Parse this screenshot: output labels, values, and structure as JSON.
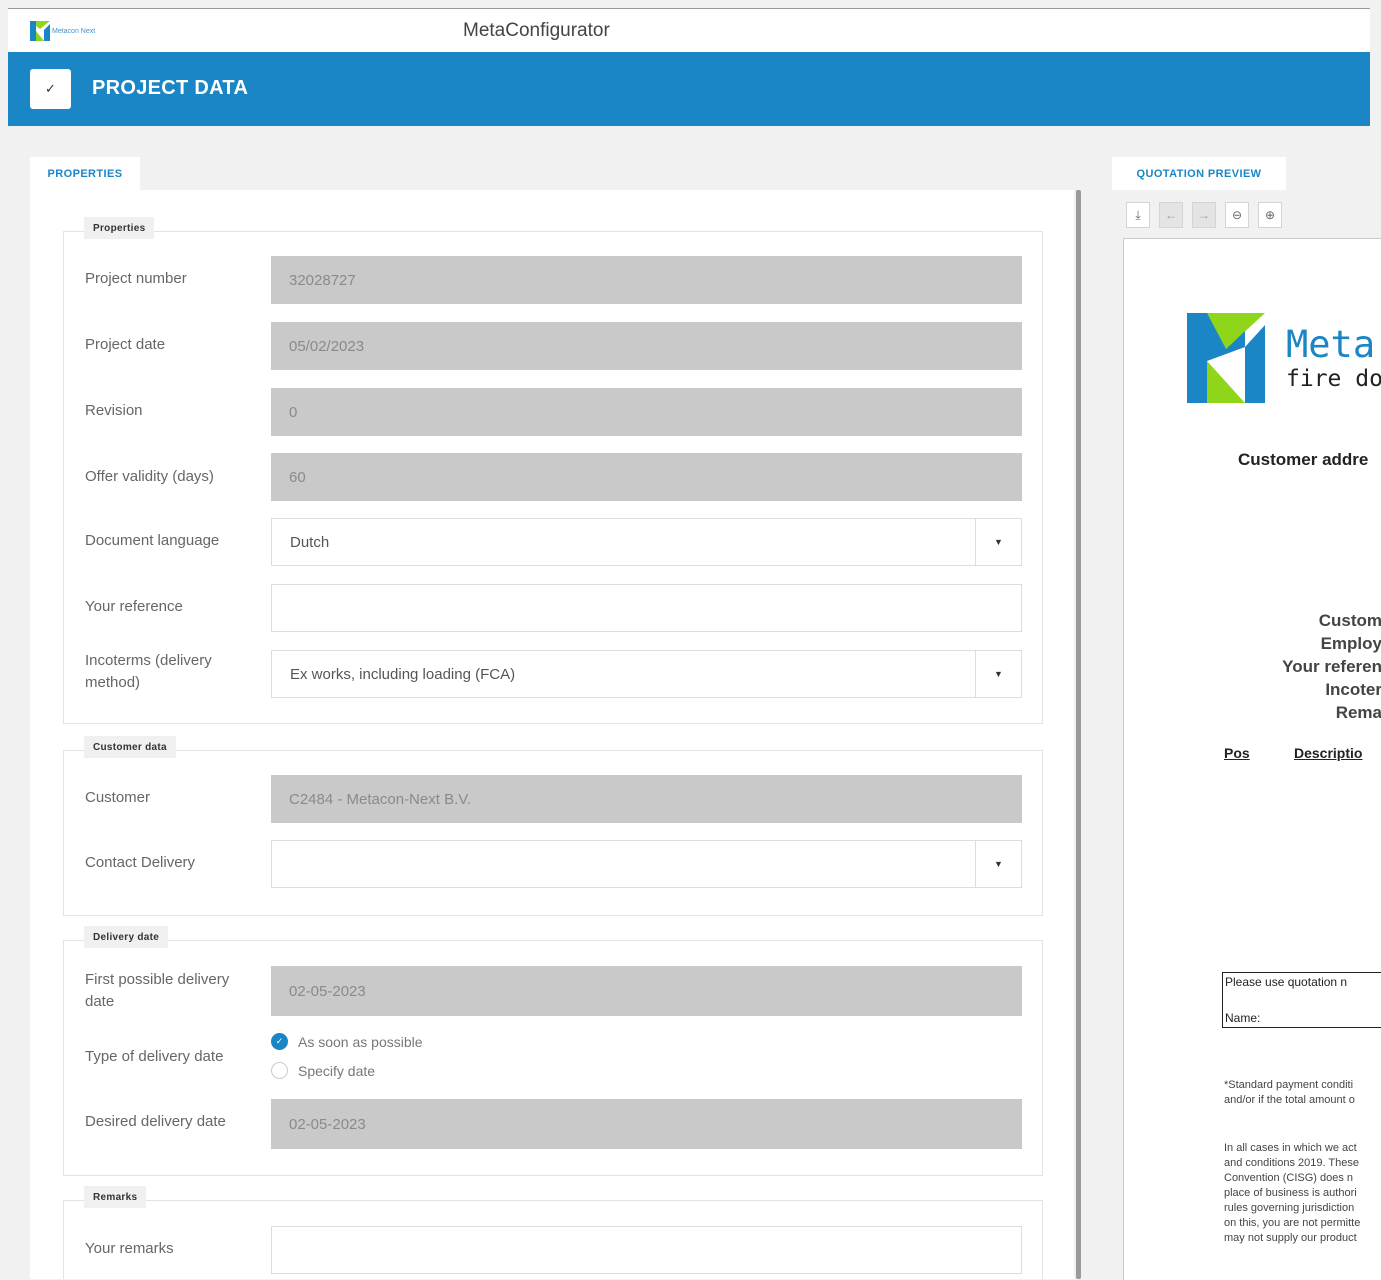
{
  "app": {
    "logo_text": "Metacon Next",
    "title": "MetaConfigurator"
  },
  "header": {
    "check_icon": "check-icon",
    "title": "PROJECT DATA"
  },
  "tabs": {
    "properties": "PROPERTIES",
    "preview": "QUOTATION PREVIEW"
  },
  "sections": {
    "properties": {
      "legend": "Properties",
      "project_number": {
        "label": "Project number",
        "value": "32028727"
      },
      "project_date": {
        "label": "Project date",
        "value": "05/02/2023"
      },
      "revision": {
        "label": "Revision",
        "value": "0"
      },
      "offer_validity": {
        "label": "Offer validity (days)",
        "value": "60"
      },
      "document_language": {
        "label": "Document language",
        "value": "Dutch"
      },
      "your_reference": {
        "label": "Your reference",
        "value": ""
      },
      "incoterms": {
        "label": "Incoterms (delivery method)",
        "value": "Ex works, including loading (FCA)"
      }
    },
    "customer": {
      "legend": "Customer data",
      "customer": {
        "label": "Customer",
        "value": "C2484 - Metacon-Next B.V."
      },
      "contact_delivery": {
        "label": "Contact Delivery",
        "value": ""
      }
    },
    "delivery": {
      "legend": "Delivery date",
      "first_possible": {
        "label": "First possible delivery date",
        "value": "02-05-2023"
      },
      "type": {
        "label": "Type of delivery date",
        "options": [
          "As soon as possible",
          "Specify date"
        ],
        "selected": "As soon as possible"
      },
      "desired": {
        "label": "Desired delivery date",
        "value": "02-05-2023"
      }
    },
    "remarks": {
      "legend": "Remarks",
      "your_remarks": {
        "label": "Your remarks",
        "value": ""
      }
    }
  },
  "preview": {
    "tools": [
      "download-icon",
      "arrow-left-icon",
      "arrow-right-icon",
      "zoom-out-icon",
      "zoom-in-icon"
    ],
    "brand_line1": "Meta",
    "brand_line2": "fire do",
    "customer_address": "Customer addre",
    "meta_lines": [
      "Custom",
      "Employ",
      "Your referen",
      "Incoter",
      "Rema"
    ],
    "col_pos": "Pos",
    "col_description": "Descriptio",
    "box_line1": "Please use quotation n",
    "box_line2": "Name:",
    "payment_lines": [
      "*Standard payment conditi",
      "and/or if the total amount o"
    ],
    "terms_lines": [
      "In all cases in which we act",
      "and conditions 2019. These",
      "Convention (CISG) does n",
      "place of business is authori",
      "rules governing jurisdiction",
      "on this, you are not permitte",
      "may not supply our product"
    ]
  },
  "colors": {
    "header": "#1b86c5",
    "readonly": "#c9c9c9",
    "logo_green": "#8fd61a",
    "logo_blue": "#1b86c5"
  }
}
